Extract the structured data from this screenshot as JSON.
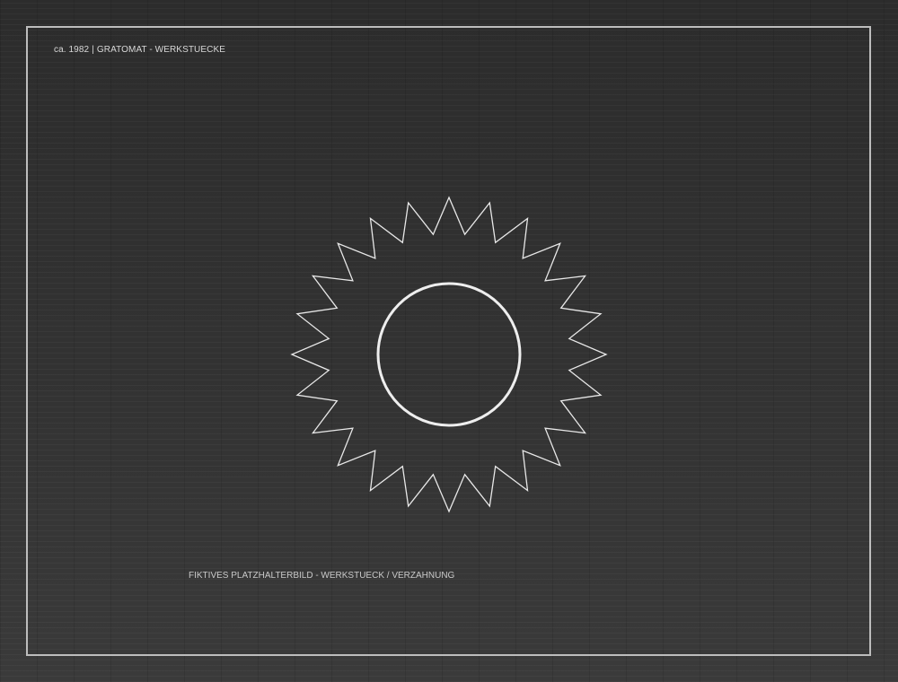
{
  "header": {
    "year": "ca. 1982",
    "separator": "|",
    "title": "GRATOMAT - WERKSTUECKE"
  },
  "illustration": {
    "name": "gear-workpiece-icon",
    "teeth": 24,
    "stroke_color": "#e8e8e8"
  },
  "footer": {
    "caption": "FIKTIVES PLATZHALTERBILD - WERKSTUECK / VERZAHNUNG"
  },
  "colors": {
    "background": "#2f2f2f",
    "frame": "#bdbdbd",
    "text": "#d8d8d8"
  }
}
